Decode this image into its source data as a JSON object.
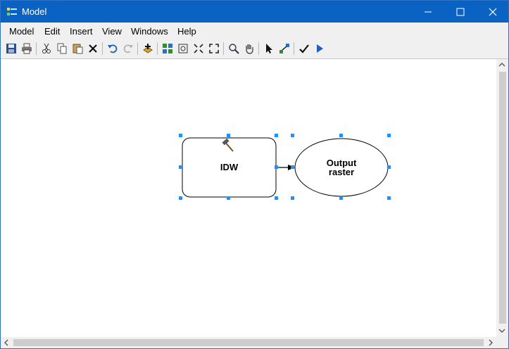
{
  "window": {
    "title": "Model"
  },
  "menu": [
    "Model",
    "Edit",
    "Insert",
    "View",
    "Windows",
    "Help"
  ],
  "toolbar": {
    "icons": [
      "save-icon",
      "print-icon",
      "cut-icon",
      "copy-icon",
      "paste-icon",
      "delete-icon",
      "undo-icon",
      "redo-icon",
      "add-data-icon",
      "auto-layout-icon",
      "full-extent-icon",
      "zoom-in-fixed-icon",
      "zoom-out-fixed-icon",
      "zoom-tool-icon",
      "pan-icon",
      "select-icon",
      "connect-icon",
      "validate-icon",
      "run-icon"
    ]
  },
  "model": {
    "tool_node": {
      "label": "IDW",
      "icon": "hammer-icon",
      "color": "#ffffff"
    },
    "output_node": {
      "label_line1": "Output",
      "label_line2": "raster",
      "color": "#ffffff"
    },
    "selection_color": "#1e90ff"
  }
}
